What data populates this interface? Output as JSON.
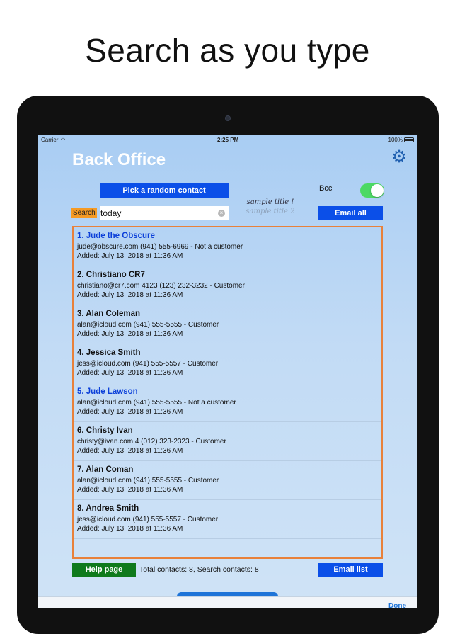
{
  "headline": "Search as you type",
  "status_bar": {
    "carrier": "Carrier",
    "time": "2:25 PM",
    "battery": "100%"
  },
  "app": {
    "title": "Back Office"
  },
  "controls": {
    "random_contact_label": "Pick a random contact",
    "sample_titles": [
      "sample title !",
      "sample title 2"
    ],
    "bcc_label": "Bcc",
    "bcc_enabled": true,
    "search_label": "Search",
    "search_value": "today",
    "email_all_label": "Email all"
  },
  "contacts": [
    {
      "name": "1.  Jude the Obscure",
      "highlight": true,
      "detail": "jude@obscure.com   (941) 555-6969 - Not a customer",
      "added": "Added: July 13, 2018 at 11:36 AM"
    },
    {
      "name": "2.  Christiano CR7",
      "highlight": false,
      "detail": "christiano@cr7.com   4123 (123) 232-3232 - Customer",
      "added": "Added: July 13, 2018 at 11:36 AM"
    },
    {
      "name": "3.  Alan Coleman",
      "highlight": false,
      "detail": "alan@icloud.com   (941) 555-5555 - Customer",
      "added": "Added: July 13, 2018 at 11:36 AM"
    },
    {
      "name": "4.  Jessica Smith",
      "highlight": false,
      "detail": "jess@icloud.com   (941) 555-5557 - Customer",
      "added": "Added: July 13, 2018 at 11:36 AM"
    },
    {
      "name": "5.  Jude Lawson",
      "highlight": true,
      "detail": "alan@icloud.com   (941) 555-5555 - Not a customer",
      "added": "Added: July 13, 2018 at 11:36 AM"
    },
    {
      "name": "6.  Christy Ivan",
      "highlight": false,
      "detail": "christy@ivan.com   4 (012) 323-2323 - Customer",
      "added": "Added: July 13, 2018 at 11:36 AM"
    },
    {
      "name": "7.  Alan Coman",
      "highlight": false,
      "detail": "alan@icloud.com   (941) 555-5555 - Customer",
      "added": "Added: July 13, 2018 at 11:36 AM"
    },
    {
      "name": "8.  Andrea Smith",
      "highlight": false,
      "detail": "jess@icloud.com   (941) 555-5557 - Customer",
      "added": "Added: July 13, 2018 at 11:36 AM"
    }
  ],
  "footer": {
    "help_label": "Help page",
    "totals": "Total contacts: 8,  Search contacts: 8",
    "email_list_label": "Email list",
    "done_label": "Done"
  }
}
